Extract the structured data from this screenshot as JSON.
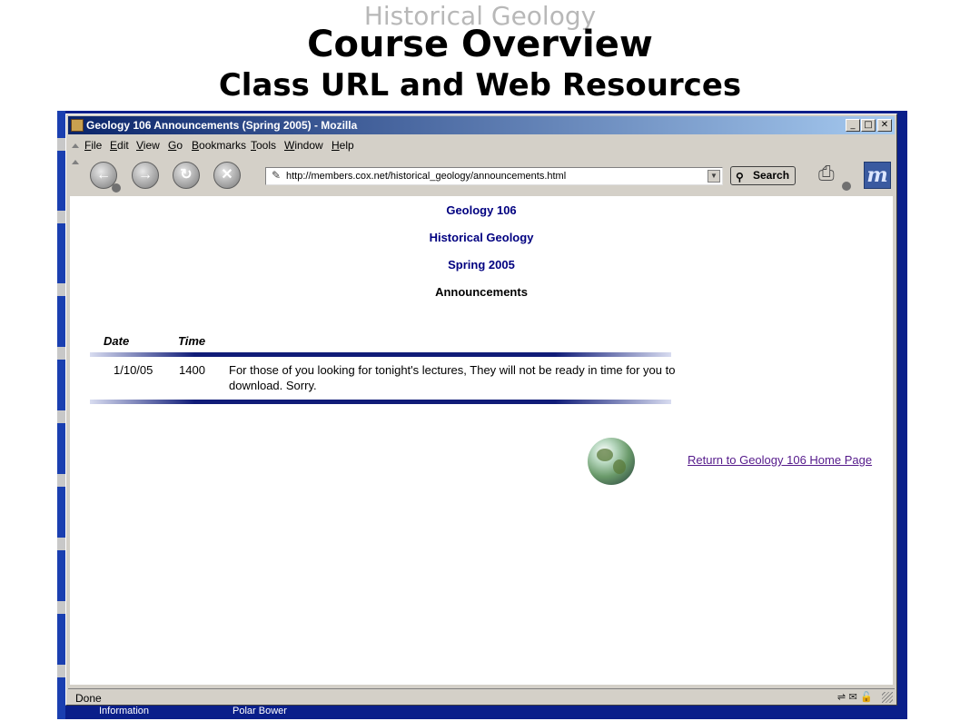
{
  "slide": {
    "subtitle": "Historical Geology",
    "title": "Course Overview",
    "heading": "Class URL and Web Resources"
  },
  "window": {
    "title": "Geology 106 Announcements (Spring 2005) - Mozilla",
    "minimize": "_",
    "maximize": "□",
    "close": "✕"
  },
  "menu": [
    {
      "key": "F",
      "rest": "ile"
    },
    {
      "key": "E",
      "rest": "dit"
    },
    {
      "key": "V",
      "rest": "iew"
    },
    {
      "key": "G",
      "rest": "o"
    },
    {
      "key": "B",
      "rest": "ookmarks"
    },
    {
      "key": "T",
      "rest": "ools"
    },
    {
      "key": "W",
      "rest": "indow"
    },
    {
      "key": "H",
      "rest": "elp"
    }
  ],
  "nav": {
    "url": "http://members.cox.net/historical_geology/announcements.html",
    "search_label": "Search",
    "back_glyph": "←",
    "forward_glyph": "→",
    "reload_glyph": "↻",
    "stop_glyph": "✕",
    "icons": [
      "back-icon",
      "forward-icon",
      "reload-icon",
      "stop-icon",
      "search-icon",
      "print-icon",
      "mozilla-logo-icon"
    ]
  },
  "page": {
    "course": "Geology 106",
    "course_name": "Historical Geology",
    "term": "Spring 2005",
    "section": "Announcements",
    "columns": {
      "date": "Date",
      "time": "Time"
    },
    "announcements": [
      {
        "date": "1/10/05",
        "time": "1400",
        "text": "For those of you looking for tonight's lectures, They will not be ready in time for you to download. Sorry."
      }
    ],
    "return_link": "Return to Geology 106 Home Page"
  },
  "status": {
    "text": "Done"
  },
  "taskbar": {
    "item1": "Information",
    "item2": "Polar Bower"
  },
  "colors": {
    "page_heading": "#000080",
    "link_visited": "#551a8b",
    "titlebar": "#0a246a",
    "desktop": "#0a1f8a"
  }
}
